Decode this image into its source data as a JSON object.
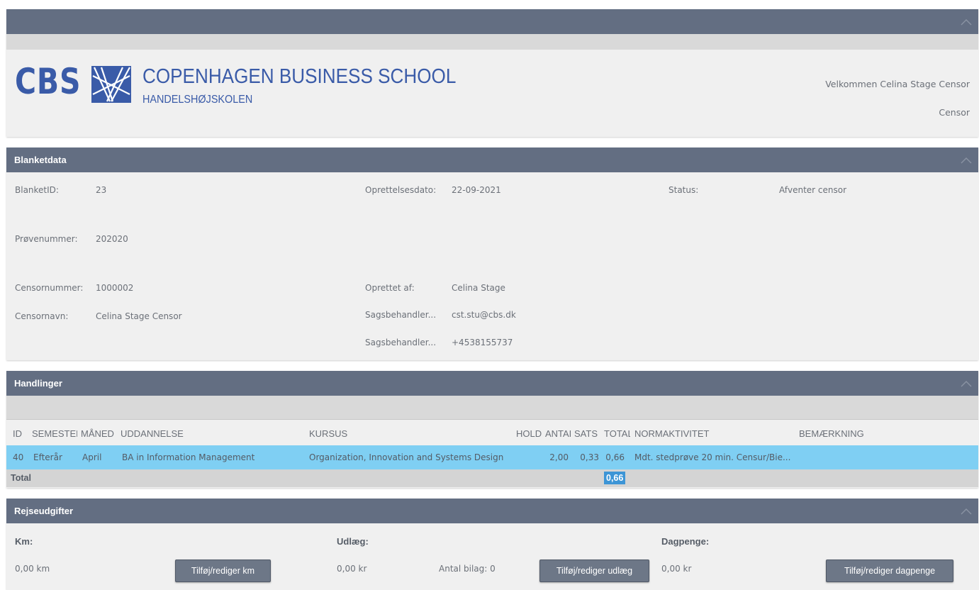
{
  "header": {
    "logo_cbs": "CBS",
    "logo_title": "COPENHAGEN BUSINESS SCHOOL",
    "logo_subtitle": "HANDELSHØJSKOLEN",
    "welcome": "Velkommen Celina  Stage Censor",
    "role": "Censor"
  },
  "blanketdata": {
    "title": "Blanketdata",
    "blanketid_label": "BlanketID:",
    "blanketid_value": "23",
    "oprettelsesdato_label": "Oprettelsesdato:",
    "oprettelsesdato_value": "22-09-2021",
    "status_label": "Status:",
    "status_value": "Afventer censor",
    "provenummer_label": "Prøvenummer:",
    "provenummer_value": "202020",
    "censornummer_label": "Censornummer:",
    "censornummer_value": "1000002",
    "oprettet_af_label": "Oprettet af:",
    "oprettet_af_value": "Celina Stage",
    "censornavn_label": "Censornavn:",
    "censornavn_value": "Celina Stage Censor",
    "sagsbehandler_email_label": "Sagsbehandler...",
    "sagsbehandler_email_value": "cst.stu@cbs.dk",
    "sagsbehandler_phone_label": "Sagsbehandler...",
    "sagsbehandler_phone_value": "+4538155737"
  },
  "handlinger": {
    "title": "Handlinger",
    "columns": {
      "id": "ID",
      "semester": "SEMESTER",
      "maaned": "MÅNED",
      "uddannelse": "UDDANNELSE",
      "kursus": "KURSUS",
      "hold": "HOLD",
      "antal": "ANTAL",
      "sats": "SATS",
      "total": "TOTAL",
      "normaktivitet": "NORMAKTIVITET",
      "bemaerkning": "BEMÆRKNING"
    },
    "rows": [
      {
        "id": "40",
        "semester": "Efterår",
        "maaned": "April",
        "uddannelse": "BA in Information Management",
        "kursus": "Organization, Innovation and Systems Design",
        "hold": "",
        "antal": "2,00",
        "sats": "0,33",
        "total": "0,66",
        "normaktivitet": "Mdt. stedprøve 20 min. Censur/Bie...",
        "bemaerkning": ""
      }
    ],
    "total_label": "Total",
    "total_value": "0,66"
  },
  "rejseudgifter": {
    "title": "Rejseudgifter",
    "km_label": "Km:",
    "km_value": "0,00 km",
    "km_button": "Tilføj/rediger km",
    "udlaeg_label": "Udlæg:",
    "udlaeg_value": "0,00 kr",
    "antal_bilag": "Antal bilag: 0",
    "udlaeg_button": "Tilføj/rediger udlæg",
    "dagpenge_label": "Dagpenge:",
    "dagpenge_value": "0,00 kr",
    "dagpenge_button": "Tilføj/rediger dagpenge"
  },
  "colors": {
    "header_bar": "#636e82",
    "panel_bg": "#f0f0f0",
    "selected_row": "#7fcff3",
    "total_highlight": "#3d95d6",
    "logo_blue": "#3a5ba8"
  },
  "icons": [
    "chevron-up-icon",
    "cbs-logo-icon"
  ]
}
